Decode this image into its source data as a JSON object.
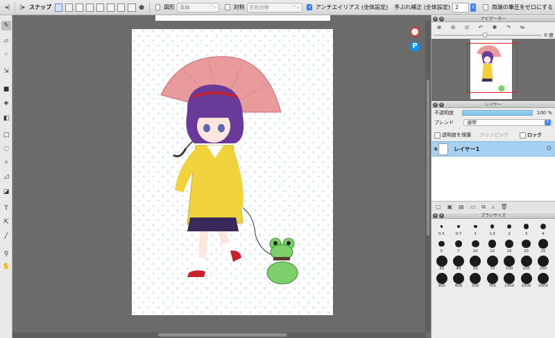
{
  "toolbar": {
    "snap_label": "スナップ",
    "shape_label": "図形",
    "shape_value": "直線",
    "symmetry_label": "対称",
    "symmetry_value": "左右対称",
    "antialias_label": "アンチエイリアス (全体設定)",
    "stabilizer_label": "手ぶれ補正 (全体設定)",
    "stabilizer_value": "2",
    "pressure_label": "両端の筆圧をゼロにする"
  },
  "navigator": {
    "title": "ナビゲーター",
    "rotation_label": "0 度"
  },
  "layers": {
    "title": "レイヤー",
    "opacity_label": "不透明度",
    "opacity_value": "100 %",
    "opacity_level": 1.0,
    "blend_label": "ブレンド",
    "blend_value": "通常",
    "protect_label": "透明度を保護",
    "clipping_label": "クリッピング",
    "lock_label": "ロック",
    "items": [
      {
        "name": "レイヤー1"
      }
    ]
  },
  "brush": {
    "title": "ブラシサイズ",
    "sizes": [
      "0.5",
      "0.7",
      "1",
      "1.5",
      "2",
      "3",
      "4",
      "5",
      "7",
      "10",
      "12",
      "15",
      "20",
      "25",
      "30",
      "40",
      "50",
      "70",
      "100",
      "150",
      "200",
      "300",
      "400",
      "500",
      "700",
      "1000",
      "1500",
      "2000"
    ]
  },
  "colors": {
    "accent": "#3b87ee",
    "layer_selected": "#a7d1f3",
    "canvas_bg": "#6b6b6b",
    "nav_frame": "#e21b1b"
  }
}
